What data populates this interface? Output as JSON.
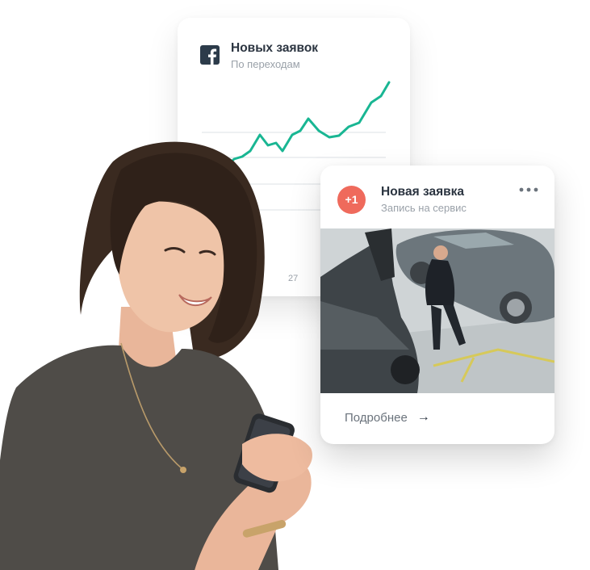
{
  "analytics_card": {
    "icon": "facebook-icon",
    "title": "Новых заявок",
    "subtitle": "По переходам",
    "x_tick": "27",
    "line_color": "#19b693"
  },
  "lead_card": {
    "badge": "+1",
    "badge_color": "#ef6a5c",
    "title": "Новая заявка",
    "subtitle": "Запись на сервис",
    "menu_icon": "more-dots-icon",
    "photo": "car-showroom-photo",
    "link_label": "Подробнее",
    "link_arrow": "→"
  },
  "hero": {
    "image": "smiling-woman-with-phone"
  }
}
